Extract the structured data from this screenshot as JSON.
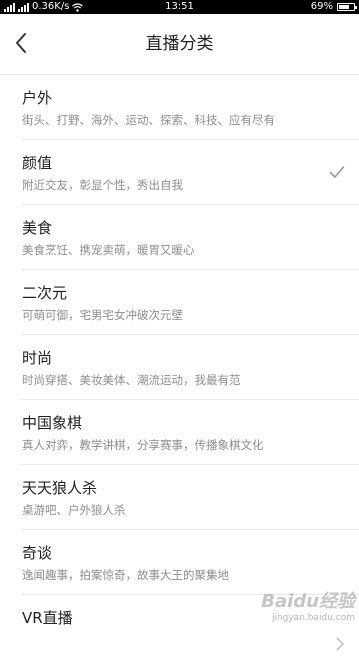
{
  "status_bar": {
    "network_speed": "0.36K/s",
    "time": "13:51",
    "battery": "69%",
    "battery_level": 0.69
  },
  "header": {
    "title": "直播分类",
    "back_icon": "chevron-left-icon"
  },
  "categories": [
    {
      "title": "户外",
      "subtitle": "街头、打野、海外、运动、探索、科技、应有尽有",
      "selected": false
    },
    {
      "title": "颜值",
      "subtitle": "附近交友，彰显个性，秀出自我",
      "selected": true
    },
    {
      "title": "美食",
      "subtitle": "美食烹饪、携宠卖萌，暖胃又暖心",
      "selected": false
    },
    {
      "title": "二次元",
      "subtitle": "可萌可御，宅男宅女冲破次元壁",
      "selected": false
    },
    {
      "title": "时尚",
      "subtitle": "时尚穿搭、美妆美体、潮流运动，我最有范",
      "selected": false
    },
    {
      "title": "中国象棋",
      "subtitle": "真人对弈，教学讲棋，分享赛事，传播象棋文化",
      "selected": false
    },
    {
      "title": "天天狼人杀",
      "subtitle": "桌游吧、户外狼人杀",
      "selected": false
    },
    {
      "title": "奇谈",
      "subtitle": "逸闻趣事，拍案惊奇，故事大王的聚集地",
      "selected": false
    },
    {
      "title": "VR直播",
      "subtitle": "",
      "selected": false
    }
  ],
  "watermark": {
    "brand": "Baidu经验",
    "url": "jingyan.baidu.com"
  }
}
